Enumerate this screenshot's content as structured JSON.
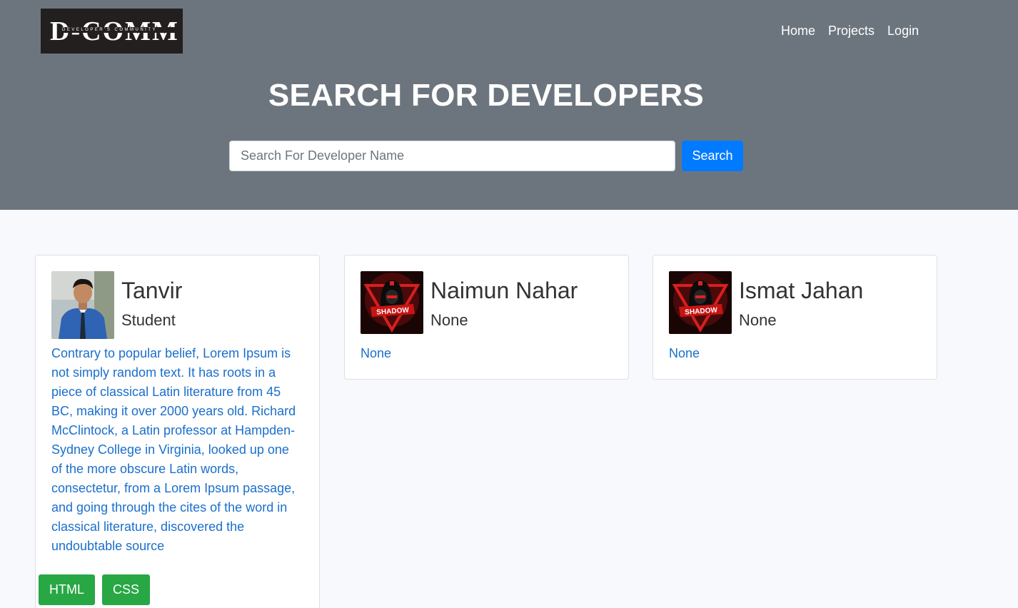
{
  "brand": {
    "logo_text": "D-COMM",
    "logo_subtext": "DEVELOPER'S COMMUNITY"
  },
  "nav": {
    "items": [
      "Home",
      "Projects",
      "Login"
    ]
  },
  "hero": {
    "title_light": "SEARCH FOR ",
    "title_bold": "DEVELOPERS"
  },
  "search": {
    "placeholder": "Search For Developer Name",
    "button_label": "Search"
  },
  "colors": {
    "header_bg": "#6c757d",
    "primary": "#007bff",
    "skill": "#28a745",
    "link": "#1a6fcc"
  },
  "developers": [
    {
      "name": "Tanvir",
      "headline": "Student",
      "avatar_icon": "profile-photo",
      "bio": "Contrary to popular belief, Lorem Ipsum is not simply random text. It has roots in a piece of classical Latin literature from 45 BC, making it over 2000 years old. Richard McClintock, a Latin professor at Hampden-Sydney College in Virginia, looked up one of the more obscure Latin words, consectetur, from a Lorem Ipsum passage, and going through the cites of the word in classical literature, discovered the undoubtable source",
      "skills": [
        "HTML",
        "CSS"
      ]
    },
    {
      "name": "Naimun Nahar",
      "headline": "None",
      "avatar_icon": "shadow-logo",
      "avatar_text": "SHADOW",
      "bio": "None",
      "skills": []
    },
    {
      "name": "Ismat Jahan",
      "headline": "None",
      "avatar_icon": "shadow-logo",
      "avatar_text": "SHADOW",
      "bio": "None",
      "skills": []
    }
  ]
}
